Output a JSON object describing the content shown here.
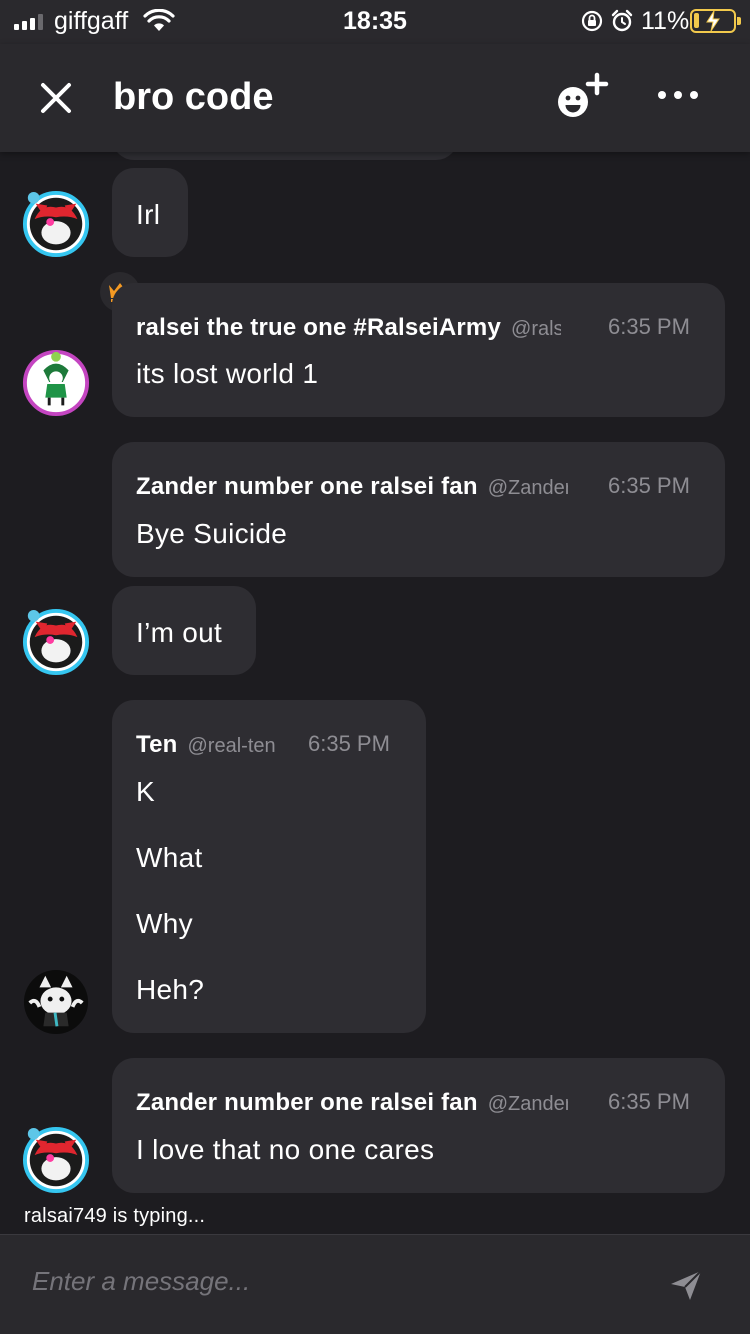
{
  "status_bar": {
    "carrier": "giffgaff",
    "time": "18:35",
    "battery_percent": "11%",
    "battery_level": 0.11,
    "signal_bars_active": 3,
    "signal_bars_total": 4
  },
  "header": {
    "title": "bro code"
  },
  "messages": [
    {
      "kind": "continuation",
      "text": "Irl"
    },
    {
      "kind": "full",
      "name": "ralsei the true one #RalseiArmy",
      "handle": "@ralsei",
      "time": "6:35 PM",
      "lines": [
        "its lost world 1"
      ],
      "badge": "crown-icon"
    },
    {
      "kind": "full",
      "name": "Zander number one ralsei fan",
      "handle": "@Zander",
      "time": "6:35 PM",
      "lines": [
        "Bye Suicide"
      ]
    },
    {
      "kind": "continuation",
      "text": "I’m out"
    },
    {
      "kind": "full",
      "name": "Ten",
      "handle": "@real-ten",
      "time": "6:35 PM",
      "lines": [
        "K",
        "What",
        "Why",
        "Heh?"
      ]
    },
    {
      "kind": "full",
      "name": "Zander number one ralsei fan",
      "handle": "@Zander",
      "time": "6:35 PM",
      "lines": [
        "I love that no one cares"
      ]
    }
  ],
  "typing_indicator": "ralsai749 is typing...",
  "composer": {
    "placeholder": "Enter a message..."
  },
  "colors": {
    "background": "#1d1c20",
    "bar": "#2a292d",
    "bubble": "#2e2d32",
    "muted_text": "#8e8d93",
    "crown": "#f59a23",
    "battery": "#f2c94c"
  }
}
